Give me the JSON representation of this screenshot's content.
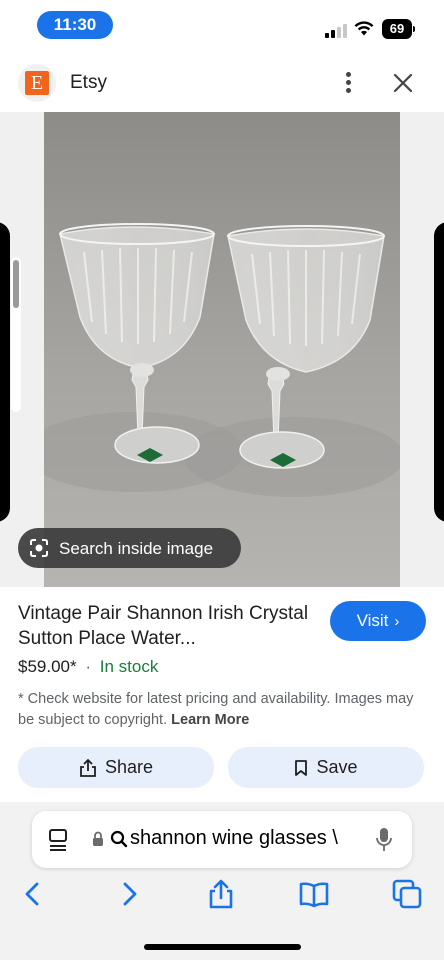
{
  "status_bar": {
    "time": "11:30",
    "battery": "69",
    "signal_bars_filled": 2,
    "signal_bars_total": 4
  },
  "site_header": {
    "logo_letter": "E",
    "site_name": "Etsy",
    "more_icon": "more-vert-icon",
    "close_icon": "close-icon"
  },
  "image_panel": {
    "lens_label": "Search inside image",
    "lens_icon": "lens-icon"
  },
  "product": {
    "title": "Vintage Pair Shannon Irish Crystal Sutton Place Water...",
    "price": "$59.00*",
    "separator": "·",
    "stock": "In stock",
    "visit_label": "Visit",
    "visit_chevron": "›",
    "disclaimer": "* Check website for latest pricing and availability. Images may be subject to copyright.",
    "learn_more": "Learn More",
    "share_label": "Share",
    "save_label": "Save"
  },
  "browser": {
    "url_text": "shannon wine glasses \\",
    "toolbar_icons": [
      "back-icon",
      "forward-icon",
      "share-icon",
      "bookmarks-icon",
      "tabs-icon"
    ]
  },
  "colors": {
    "accent_blue": "#1a73e8",
    "stock_green": "#188038",
    "etsy_orange": "#f1641e",
    "pill_bg": "#e8effc"
  }
}
